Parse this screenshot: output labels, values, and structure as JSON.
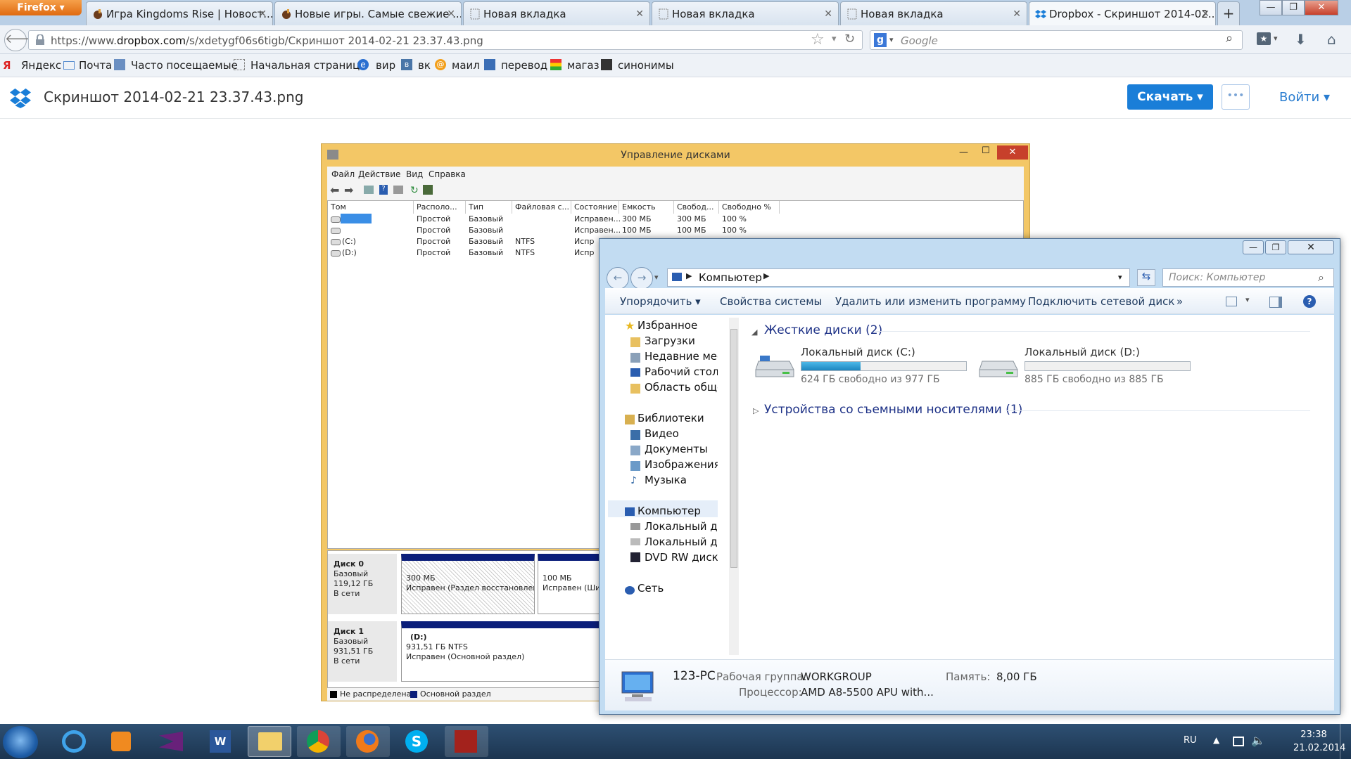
{
  "browser": {
    "menu_button": "Firefox",
    "tabs": [
      {
        "title": "Игра Kingdoms Rise | Новост..."
      },
      {
        "title": "Новые игры. Самые свежие ..."
      },
      {
        "title": "Новая вкладка"
      },
      {
        "title": "Новая вкладка"
      },
      {
        "title": "Новая вкладка"
      },
      {
        "title": "Dropbox - Скриншот 2014-02..."
      }
    ],
    "url_prefix": "https://www.",
    "url_domain": "dropbox.com",
    "url_path": "/s/xdetygf06s6tigb/Скриншот 2014-02-21 23.37.43.png",
    "search_placeholder": "Google",
    "bookmarks": [
      "Яндекс",
      "Почта",
      "Часто посещаемые",
      "Начальная страница",
      "вир",
      "вк",
      "маил",
      "перевод",
      "магаз",
      "синонимы"
    ]
  },
  "dropbox": {
    "file_title": "Скриншот 2014-02-21 23.37.43.png",
    "download_label": "Скачать ▾",
    "more_label": "•••",
    "login_label": "Войти ▾"
  },
  "diskmgmt": {
    "title": "Управление дисками",
    "menu": [
      "Файл",
      "Действие",
      "Вид",
      "Справка"
    ],
    "columns": [
      "Том",
      "Располо...",
      "Тип",
      "Файловая с...",
      "Состояние",
      "Емкость",
      "Свобод...",
      "Свободно %"
    ],
    "rows": [
      {
        "vol": "",
        "layout": "Простой",
        "type": "Базовый",
        "fs": "",
        "status": "Исправен...",
        "cap": "300 МБ",
        "free": "300 МБ",
        "pct": "100 %"
      },
      {
        "vol": "",
        "layout": "Простой",
        "type": "Базовый",
        "fs": "",
        "status": "Исправен...",
        "cap": "100 МБ",
        "free": "100 МБ",
        "pct": "100 %"
      },
      {
        "vol": "(C:)",
        "layout": "Простой",
        "type": "Базовый",
        "fs": "NTFS",
        "status": "Испр",
        "cap": "",
        "free": "",
        "pct": ""
      },
      {
        "vol": "(D:)",
        "layout": "Простой",
        "type": "Базовый",
        "fs": "NTFS",
        "status": "Испр",
        "cap": "",
        "free": "",
        "pct": ""
      }
    ],
    "disk0": {
      "name": "Диск 0",
      "type": "Базовый",
      "size": "119,12 ГБ",
      "state": "В сети",
      "p1_size": "300 МБ",
      "p1_status": "Исправен (Раздел восстановлени",
      "p2_size": "100 МБ",
      "p2_status": "Исправен (Шиф"
    },
    "disk1": {
      "name": "Диск 1",
      "type": "Базовый",
      "size": "931,51 ГБ",
      "state": "В сети",
      "p1_name": "(D:)",
      "p1_size": "931,51 ГБ NTFS",
      "p1_status": "Исправен (Основной раздел)"
    },
    "legend": [
      "Не распределена",
      "Основной раздел"
    ]
  },
  "explorer": {
    "address": "Компьютер",
    "search_placeholder": "Поиск: Компьютер",
    "commands": [
      "Упорядочить ▾",
      "Свойства системы",
      "Удалить или изменить программу",
      "Подключить сетевой диск",
      "»"
    ],
    "nav": {
      "favorites": "Избранное",
      "fav_items": [
        "Загрузки",
        "Недавние места",
        "Рабочий стол",
        "Область общего"
      ],
      "libraries": "Библиотеки",
      "lib_items": [
        "Видео",
        "Документы",
        "Изображения",
        "Музыка"
      ],
      "computer": "Компьютер",
      "comp_items": [
        "Локальный диск",
        "Локальный диск",
        "DVD RW дисково"
      ],
      "network": "Сеть"
    },
    "hdd_header": "Жесткие диски (2)",
    "removable_header": "Устройства со съемными носителями (1)",
    "drives": [
      {
        "name": "Локальный диск (C:)",
        "free": "624 ГБ свободно из 977 ГБ",
        "used_fraction": 0.36
      },
      {
        "name": "Локальный диск (D:)",
        "free": "885 ГБ свободно из 885 ГБ",
        "used_fraction": 0.0
      }
    ],
    "status": {
      "pc": "123-PC",
      "wg_label": "Рабочая группа:",
      "wg_value": "WORKGROUP",
      "mem_label": "Память:",
      "mem_value": "8,00 ГБ",
      "cpu_label": "Процессор:",
      "cpu_value": "AMD A8-5500 APU with..."
    }
  },
  "taskbar": {
    "lang": "RU",
    "time": "23:38",
    "date": "21.02.2014"
  },
  "colors": {
    "dropbox_blue": "#1a7ed8",
    "dm_frame": "#f3c766",
    "explorer_frame": "#c2dcf2",
    "progress": "#26a0da"
  }
}
